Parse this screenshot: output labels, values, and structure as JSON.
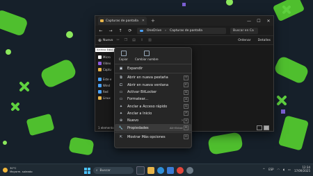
{
  "window": {
    "tab_title": "Capturas de pantalla",
    "new_tab": "+",
    "controls": [
      "—",
      "☐",
      "✕"
    ],
    "address": {
      "root": "OneDrive",
      "separator": "›",
      "current": "Capturas de pantalla"
    },
    "search_placeholder": "Buscar en Ca",
    "toolbar": {
      "new_label": "Nuevo",
      "sort_label": "Ordenar",
      "details_label": "Detalles"
    },
    "breadcrumb_strip": "Archivo   Edici",
    "sidebar": [
      {
        "label": "Micro",
        "color": "#ffffff"
      },
      {
        "label": "Vídeo",
        "color": "#8e5ce0"
      },
      {
        "label": "Captu",
        "color": "#e8b54a"
      },
      {
        "label": "Este e",
        "color": "#4aa3ff"
      },
      {
        "label": "Wind",
        "color": "#4aa3ff"
      },
      {
        "label": "Red",
        "color": "#4aa3ff"
      },
      {
        "label": "Linux",
        "color": "#e8b54a"
      }
    ],
    "status": "1 elemento"
  },
  "context_menu": {
    "top_actions": [
      {
        "label": "Copiar",
        "icon": "copy-icon"
      },
      {
        "label": "Cambiar nombre",
        "icon": "rename-icon"
      }
    ],
    "items": [
      {
        "label": "Expandir",
        "icon": "expand-icon",
        "key": "",
        "shortcut": "",
        "submenu": false
      },
      {
        "label": "Abrir en nueva pestaña",
        "icon": "new-tab-icon",
        "key": "T",
        "shortcut": "",
        "submenu": false
      },
      {
        "label": "Abrir en nueva ventana",
        "icon": "new-window-icon",
        "key": "E",
        "shortcut": "",
        "submenu": false
      },
      {
        "label": "Activar BitLocker",
        "icon": "bitlocker-icon",
        "key": "B",
        "shortcut": "",
        "submenu": false
      },
      {
        "label": "Formatear...",
        "icon": "format-icon",
        "key": "A",
        "shortcut": "",
        "submenu": false
      },
      {
        "label": "Anclar a Acceso rápido",
        "icon": "pin-icon",
        "key": "Q",
        "shortcut": "",
        "submenu": false
      },
      {
        "label": "Anclar a Inicio",
        "icon": "pin-start-icon",
        "key": "P",
        "shortcut": "",
        "submenu": false
      },
      {
        "label": "Nuevo",
        "icon": "new-icon",
        "key": "X",
        "shortcut": "",
        "submenu": true
      },
      {
        "label": "Propiedades",
        "icon": "properties-icon",
        "key": "R",
        "shortcut": "Alt+Entrar",
        "submenu": false
      },
      {
        "label": "Mostrar Más opciones",
        "icon": "more-options-icon",
        "key": "O",
        "shortcut": "",
        "submenu": false
      }
    ]
  },
  "taskbar": {
    "temperature": "30°C",
    "weather": "Mayorm. soleado",
    "search_placeholder": "Buscar",
    "language": "ESP",
    "time": "12:34",
    "date": "17/09/2025"
  },
  "colors": {
    "wallpaper": "#16202a",
    "accent_green": "#5fd13f",
    "taskbar": "#1f2a33"
  }
}
